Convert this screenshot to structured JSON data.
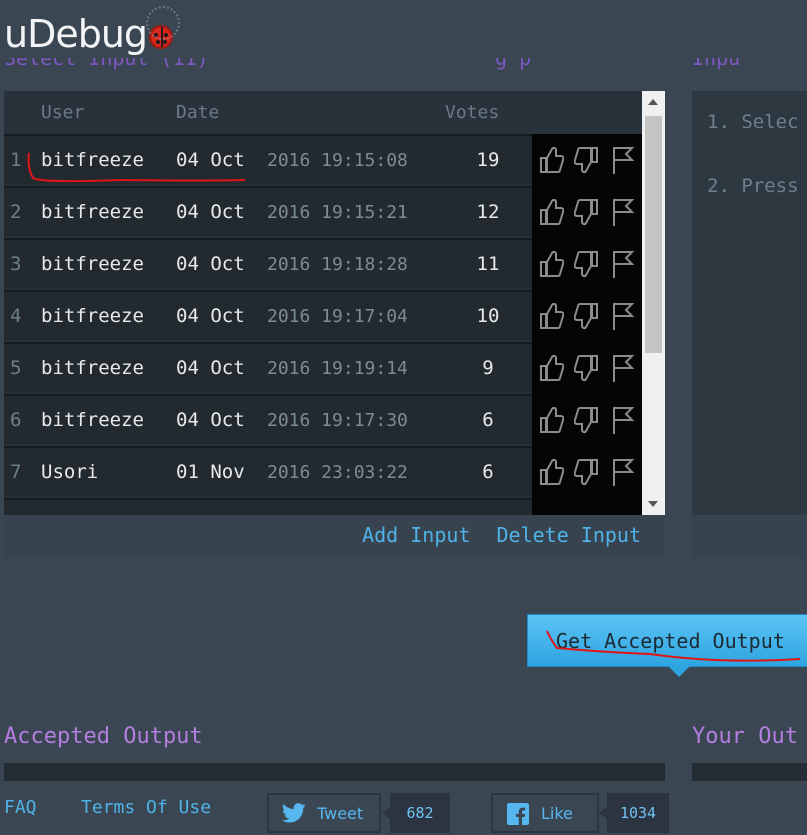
{
  "app": {
    "logo_text": "uDebug",
    "left_heading_fragment": "Select Input (11)",
    "mid_heading_fragment": "g  p",
    "right_heading_fragment": "Inpu"
  },
  "input_table": {
    "headers": {
      "user": "User",
      "date": "Date",
      "votes": "Votes"
    },
    "rows": [
      {
        "n": "1",
        "user": "bitfreeze",
        "date_day": "04 Oct",
        "date_rest": "2016 19:15:08",
        "votes": "19"
      },
      {
        "n": "2",
        "user": "bitfreeze",
        "date_day": "04 Oct",
        "date_rest": "2016 19:15:21",
        "votes": "12"
      },
      {
        "n": "3",
        "user": "bitfreeze",
        "date_day": "04 Oct",
        "date_rest": "2016 19:18:28",
        "votes": "11"
      },
      {
        "n": "4",
        "user": "bitfreeze",
        "date_day": "04 Oct",
        "date_rest": "2016 19:17:04",
        "votes": "10"
      },
      {
        "n": "5",
        "user": "bitfreeze",
        "date_day": "04 Oct",
        "date_rest": "2016 19:19:14",
        "votes": "9"
      },
      {
        "n": "6",
        "user": "bitfreeze",
        "date_day": "04 Oct",
        "date_rest": "2016 19:17:30",
        "votes": "6"
      },
      {
        "n": "7",
        "user": "Usori",
        "date_day": "01 Nov",
        "date_rest": "2016 23:03:22",
        "votes": "6"
      }
    ],
    "actions": {
      "add": "Add Input",
      "delete": "Delete Input"
    },
    "icons": [
      "thumbs-up-icon",
      "thumbs-down-icon",
      "flag-icon"
    ]
  },
  "instructions": {
    "step1": "1. Selec",
    "step2": "2. Press"
  },
  "get_accepted_button": "Get Accepted Output",
  "outputs": {
    "accepted_heading": "Accepted Output",
    "yours_heading": "Your Out"
  },
  "footer": {
    "faq": "FAQ",
    "terms": "Terms Of Use",
    "tweet_label": "Tweet",
    "tweet_count": "682",
    "like_label": "Like",
    "like_count": "1034"
  },
  "colors": {
    "background": "#3a4652",
    "link": "#4fb3e8",
    "heading_purple": "#b47ee0",
    "accent_button": "#2ea4e0",
    "annotation_red": "#e01515"
  }
}
